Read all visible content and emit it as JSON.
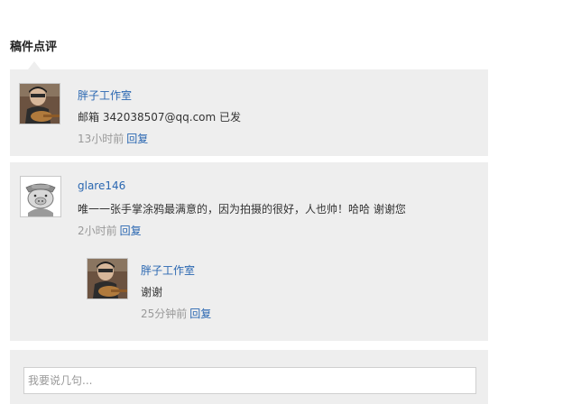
{
  "section": {
    "title": "稿件点评"
  },
  "comments": [
    {
      "author": "胖子工作室",
      "text": "邮箱 342038507@qq.com 已发",
      "time": "13小时前",
      "reply_label": "回复"
    },
    {
      "author": "glare146",
      "text": "唯一一张手掌涂鸦最满意的，因为拍摄的很好，人也帅！哈哈 谢谢您",
      "time": "2小时前",
      "reply_label": "回复",
      "replies": [
        {
          "author": "胖子工作室",
          "text": "谢谢",
          "time": "25分钟前",
          "reply_label": "回复"
        }
      ]
    }
  ],
  "composer": {
    "placeholder": "我要说几句..."
  }
}
